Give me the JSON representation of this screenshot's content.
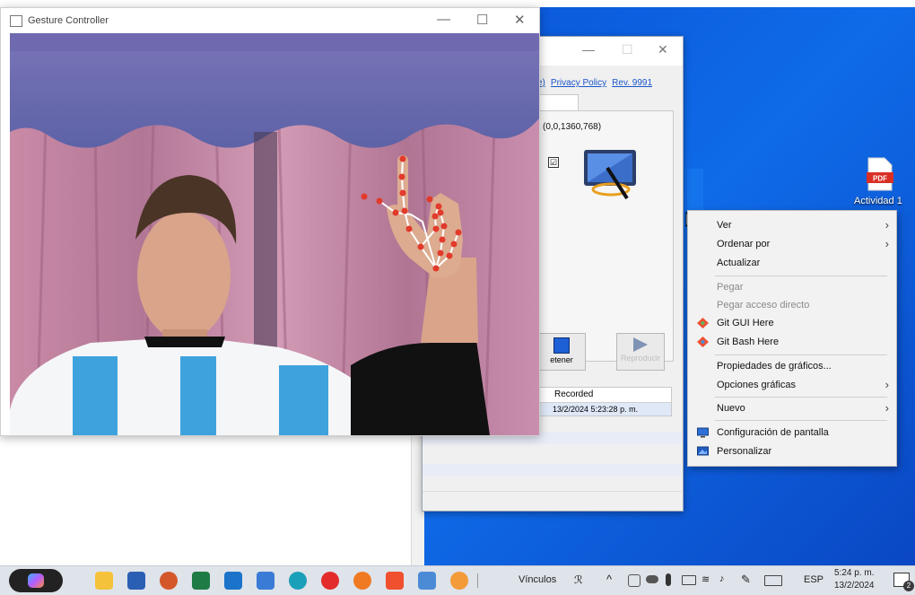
{
  "gesture_window": {
    "title": "Gesture Controller",
    "minimize": "—",
    "maximize": "☐",
    "close": "✕"
  },
  "background_window": {
    "minimize": "—",
    "maximize": "☐",
    "close": "✕",
    "link_partial": "e)",
    "privacy_policy": "Privacy Policy",
    "revision": "Rev. 9991",
    "coords": "(0,0,1360,768)",
    "checkbox": "☑",
    "stop_button": "etener",
    "play_button": "Reproducir",
    "table_header": "Recorded",
    "table_row": "13/2/2024 5:23:28 p. m."
  },
  "context_menu": {
    "items": [
      {
        "label": "Ver",
        "submenu": true,
        "disabled": false
      },
      {
        "label": "Ordenar por",
        "submenu": true,
        "disabled": false
      },
      {
        "label": "Actualizar",
        "submenu": false,
        "disabled": false
      },
      {
        "label": "Pegar",
        "submenu": false,
        "disabled": true
      },
      {
        "label": "Pegar acceso directo",
        "submenu": false,
        "disabled": true
      },
      {
        "label": "Git GUI Here",
        "submenu": false,
        "disabled": false,
        "icon": "git-gui-icon"
      },
      {
        "label": "Git Bash Here",
        "submenu": false,
        "disabled": false,
        "icon": "git-bash-icon"
      },
      {
        "label": "Propiedades de gráficos...",
        "submenu": false,
        "disabled": false
      },
      {
        "label": "Opciones gráficas",
        "submenu": true,
        "disabled": false
      },
      {
        "label": "Nuevo",
        "submenu": true,
        "disabled": false
      },
      {
        "label": "Configuración de pantalla",
        "submenu": false,
        "disabled": false,
        "icon": "display-settings-icon"
      },
      {
        "label": "Personalizar",
        "submenu": false,
        "disabled": false,
        "icon": "personalize-icon"
      }
    ],
    "chevron": "›"
  },
  "desktop": {
    "pdf_icon_text": "PDF",
    "pdf_label": "Actividad 1"
  },
  "taskbar": {
    "links_label": "Vínculos",
    "language": "ESP",
    "time": "5:24 p. m.",
    "date": "13/2/2024",
    "notification_count": "2",
    "copilot_icon": "copilot-icon",
    "icons": [
      "file-explorer-icon",
      "word-icon",
      "powerpoint-icon",
      "excel-icon",
      "mail-icon",
      "store-icon",
      "edge-icon",
      "opera-icon",
      "firefox-icon",
      "brave-icon",
      "python-idle-icon",
      "gesture-hand-icon"
    ]
  },
  "colors": {
    "desktop_blue": "#0f6be8",
    "taskbar_bg": "#dfe3ea",
    "landmark_red": "#e23a2b"
  }
}
